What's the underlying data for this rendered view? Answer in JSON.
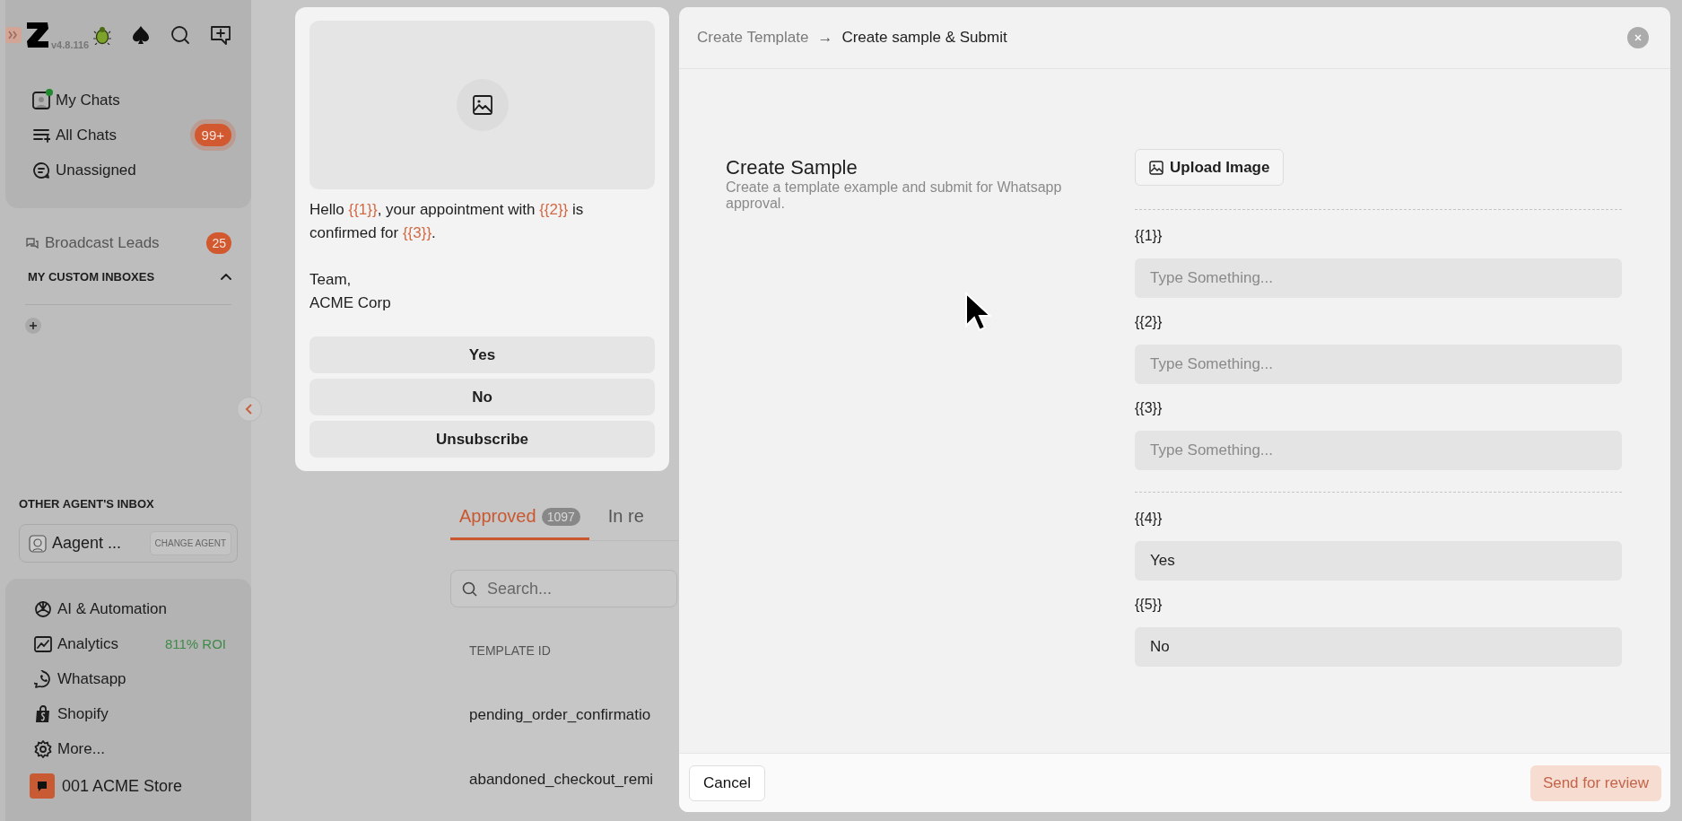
{
  "sidebar": {
    "version": "v4.8.116",
    "nav": [
      {
        "label": "My Chats",
        "online": true
      },
      {
        "label": "All Chats",
        "online": false,
        "badge": "99+"
      },
      {
        "label": "Unassigned",
        "online": false
      }
    ],
    "broadcast": {
      "label": "Broadcast Leads",
      "badge": "25"
    },
    "custom_inboxes": {
      "heading": "MY CUSTOM INBOXES",
      "expanded": true
    },
    "other_agent": {
      "heading": "OTHER AGENT'S INBOX",
      "agent": "Aagent ...",
      "button": "CHANGE AGENT"
    },
    "tools": [
      {
        "label": "AI & Automation"
      },
      {
        "label": "Analytics",
        "note": "811% ROI"
      },
      {
        "label": "Whatsapp"
      },
      {
        "label": "Shopify"
      },
      {
        "label": "More..."
      }
    ],
    "store": {
      "label": "001 ACME Store"
    }
  },
  "templates": {
    "tabs": [
      {
        "label": "Approved",
        "count": "1097",
        "selected": true
      },
      {
        "label": "In re",
        "selected": false
      }
    ],
    "search": {
      "placeholder": "Search..."
    },
    "columns": [
      "TEMPLATE ID"
    ],
    "rows": [
      "pending_order_confirmatio",
      "abandoned_checkout_remi"
    ]
  },
  "preview": {
    "body": [
      {
        "text": "Hello ",
        "kind": "plain"
      },
      {
        "text": "{{1}}",
        "kind": "variable"
      },
      {
        "text": ", your appointment with ",
        "kind": "plain"
      },
      {
        "text": "{{2}}",
        "kind": "variable"
      },
      {
        "text": " is confirmed for ",
        "kind": "plain"
      },
      {
        "text": "{{3}}",
        "kind": "variable"
      },
      {
        "text": ".",
        "kind": "plain"
      }
    ],
    "signature": "Team,\nACME Corp",
    "buttons": [
      "Yes",
      "No",
      "Unsubscribe"
    ]
  },
  "panel": {
    "breadcrumb": [
      "Create Template",
      "Create sample & Submit"
    ],
    "separator": "→",
    "title": "Create Sample",
    "description": "Create a template example and submit for Whatsapp approval.",
    "upload": "Upload Image",
    "groups": [
      [
        {
          "label": "{{1}}",
          "placeholder": "Type Something..."
        },
        {
          "label": "{{2}}",
          "placeholder": "Type Something..."
        },
        {
          "label": "{{3}}",
          "placeholder": "Type Something..."
        }
      ],
      [
        {
          "label": "{{4}}",
          "value": "Yes"
        },
        {
          "label": "{{5}}",
          "value": "No"
        }
      ]
    ],
    "cancel": "Cancel",
    "submit": {
      "label": "Send for review",
      "disabled": true
    }
  }
}
